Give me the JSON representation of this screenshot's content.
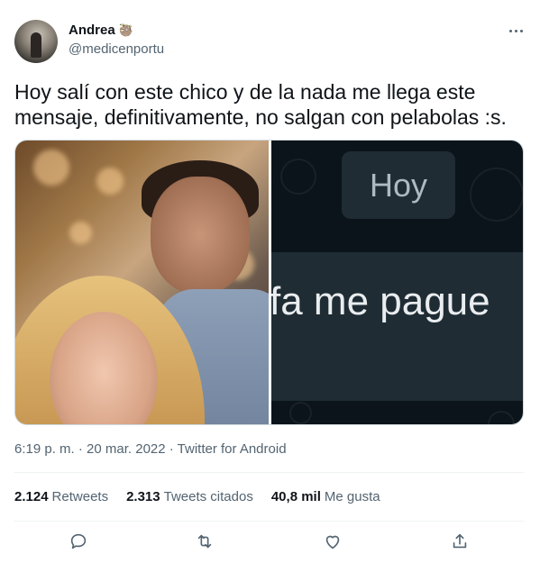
{
  "author": {
    "display_name": "Andrea",
    "name_emoji": "🦥",
    "handle": "@medicenportu"
  },
  "tweet": {
    "text": "Hoy salí con este chico y de la nada me llega este mensaje, definitivamente, no salgan con pelabolas :s."
  },
  "media": {
    "right_panel": {
      "bubble_top_text": "Hoy",
      "bubble_main_text": "fa me pague"
    }
  },
  "meta": {
    "timestamp": "6:19 p. m. · 20 mar. 2022 · Twitter for Android"
  },
  "stats": {
    "retweets": {
      "count": "2.124",
      "label": "Retweets"
    },
    "quotes": {
      "count": "2.313",
      "label": "Tweets citados"
    },
    "likes": {
      "count": "40,8 mil",
      "label": "Me gusta"
    }
  },
  "icons": {
    "reply": "reply-icon",
    "retweet": "retweet-icon",
    "like": "heart-icon",
    "share": "share-icon",
    "more": "more-icon"
  },
  "colors": {
    "text_primary": "#0f1419",
    "text_secondary": "#536471",
    "divider": "#eff3f4",
    "border": "#cfd9de"
  }
}
